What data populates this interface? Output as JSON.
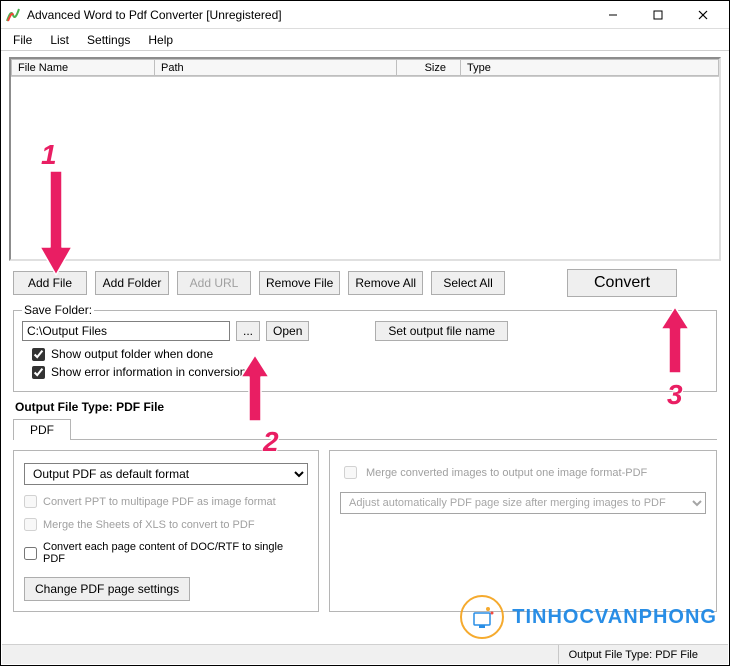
{
  "window": {
    "title": "Advanced Word to Pdf Converter [Unregistered]"
  },
  "menu": {
    "file": "File",
    "list": "List",
    "settings": "Settings",
    "help": "Help"
  },
  "table": {
    "col_name": "File Name",
    "col_path": "Path",
    "col_size": "Size",
    "col_type": "Type"
  },
  "toolbar": {
    "add_file": "Add File",
    "add_folder": "Add Folder",
    "add_url": "Add URL",
    "remove_file": "Remove File",
    "remove_all": "Remove All",
    "select_all": "Select All",
    "convert": "Convert"
  },
  "save_folder": {
    "legend": "Save Folder:",
    "path": "C:\\Output Files",
    "browse": "...",
    "open": "Open",
    "set_output": "Set output file name",
    "show_output": "Show output folder when done",
    "show_errors": "Show error information in conversion"
  },
  "output_type_label": "Output File Type:  PDF File",
  "tabs": {
    "pdf": "PDF"
  },
  "left_panel": {
    "format_select": "Output PDF as default format",
    "convert_ppt": "Convert PPT to multipage PDF as image format",
    "merge_xls": "Merge the Sheets of XLS to convert to PDF",
    "each_page": "Convert each page content of DOC/RTF to single PDF",
    "change_settings": "Change PDF page settings"
  },
  "right_panel": {
    "merge_images": "Merge converted images to output one image format-PDF",
    "adjust_select": "Adjust automatically PDF page size after merging images to PDF"
  },
  "status": "Output File Type:  PDF File",
  "annotations": {
    "n1": "1",
    "n2": "2",
    "n3": "3"
  },
  "watermark": "TINHOCVANPHONG"
}
